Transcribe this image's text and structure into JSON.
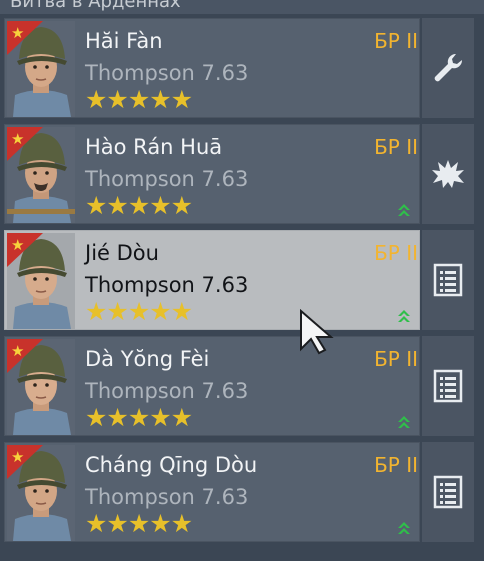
{
  "header": {
    "title_partial": "Битва в Арденнах"
  },
  "colors": {
    "br": "#f2b430",
    "stars": "#e7c02a",
    "selected_bg": "#b9bcbf",
    "rank_up": "#2fbf4a"
  },
  "soldiers": [
    {
      "name": "Hăi Fàn",
      "weapon": "Thompson 7.63",
      "stars": "★★★★★",
      "br": "БР II",
      "action_icon": "wrench-icon",
      "rank_up": false
    },
    {
      "name": "Hào Rán Huā",
      "weapon": "Thompson 7.63",
      "stars": "★★★★★",
      "br": "БР II",
      "action_icon": "explosion-icon",
      "rank_up": true
    },
    {
      "name": "Jié Dòu",
      "weapon": "Thompson 7.63",
      "stars": "★★★★★",
      "br": "БР II",
      "action_icon": "list-icon",
      "rank_up": true,
      "selected": true
    },
    {
      "name": "Dà Yŏng Fèi",
      "weapon": "Thompson 7.63",
      "stars": "★★★★★",
      "br": "БР II",
      "action_icon": "list-icon",
      "rank_up": true
    },
    {
      "name": "Cháng Qīng Dòu",
      "weapon": "Thompson 7.63",
      "stars": "★★★★★",
      "br": "БР II",
      "action_icon": "list-icon",
      "rank_up": true
    }
  ]
}
